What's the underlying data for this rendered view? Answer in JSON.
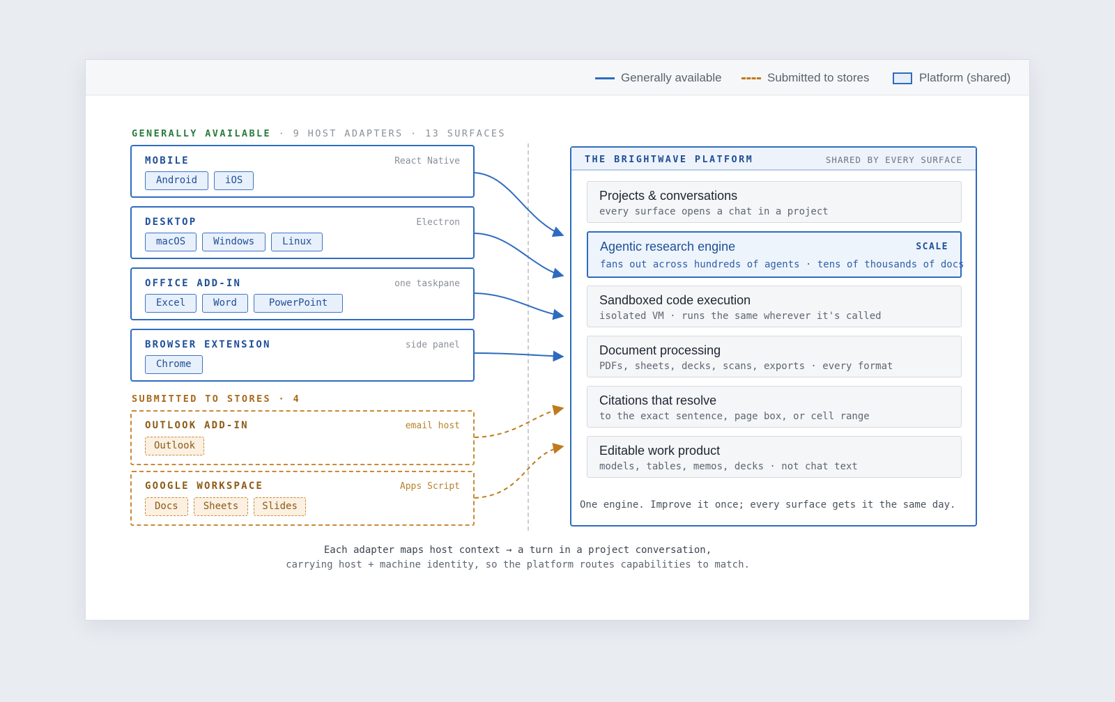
{
  "legend": {
    "items": [
      {
        "label": "Generally available",
        "style": "solid",
        "color": "#2e6bbf"
      },
      {
        "label": "Submitted to stores",
        "style": "dashed",
        "color": "#c07a1e"
      },
      {
        "label": "Platform (shared)",
        "style": "box",
        "color": "#2e6bbf"
      }
    ]
  },
  "generally_available": {
    "heading": "GENERALLY AVAILABLE",
    "count_text": "· 9 HOST ADAPTERS · 13 SURFACES",
    "adapters": [
      {
        "name": "MOBILE",
        "tech": "React Native",
        "surfaces": [
          "Android",
          "iOS"
        ]
      },
      {
        "name": "DESKTOP",
        "tech": "Electron",
        "surfaces": [
          "macOS",
          "Windows",
          "Linux"
        ]
      },
      {
        "name": "OFFICE ADD-IN",
        "tech": "one taskpane",
        "surfaces": [
          "Excel",
          "Word",
          "PowerPoint"
        ]
      },
      {
        "name": "BROWSER EXTENSION",
        "tech": "side panel",
        "surfaces": [
          "Chrome"
        ]
      }
    ]
  },
  "submitted": {
    "heading": "SUBMITTED TO STORES · 4",
    "adapters": [
      {
        "name": "OUTLOOK ADD-IN",
        "tech": "email host",
        "surfaces": [
          "Outlook"
        ]
      },
      {
        "name": "GOOGLE WORKSPACE",
        "tech": "Apps Script",
        "surfaces": [
          "Docs",
          "Sheets",
          "Slides"
        ]
      }
    ]
  },
  "platform": {
    "title": "THE BRIGHTWAVE PLATFORM",
    "subtitle": "SHARED BY EVERY SURFACE",
    "capabilities": [
      {
        "title": "Projects & conversations",
        "desc": "every surface opens a chat in a project"
      },
      {
        "title": "Agentic research engine",
        "desc": "fans out across hundreds of agents · tens of thousands of docs",
        "badge": "SCALE"
      },
      {
        "title": "Sandboxed code execution",
        "desc": "isolated VM · runs the same wherever it's called"
      },
      {
        "title": "Document processing",
        "desc": "PDFs, sheets, decks, scans, exports · every format"
      },
      {
        "title": "Citations that resolve",
        "desc": "to the exact sentence, page box, or cell range"
      },
      {
        "title": "Editable work product",
        "desc": "models, tables, memos, decks · not chat text"
      }
    ],
    "footer": "One engine. Improve it once; every surface gets it the same day."
  },
  "caption": {
    "line1": "Each adapter maps host context → a turn in a project conversation,",
    "line2": "carrying host + machine identity, so the platform routes capabilities to match."
  }
}
